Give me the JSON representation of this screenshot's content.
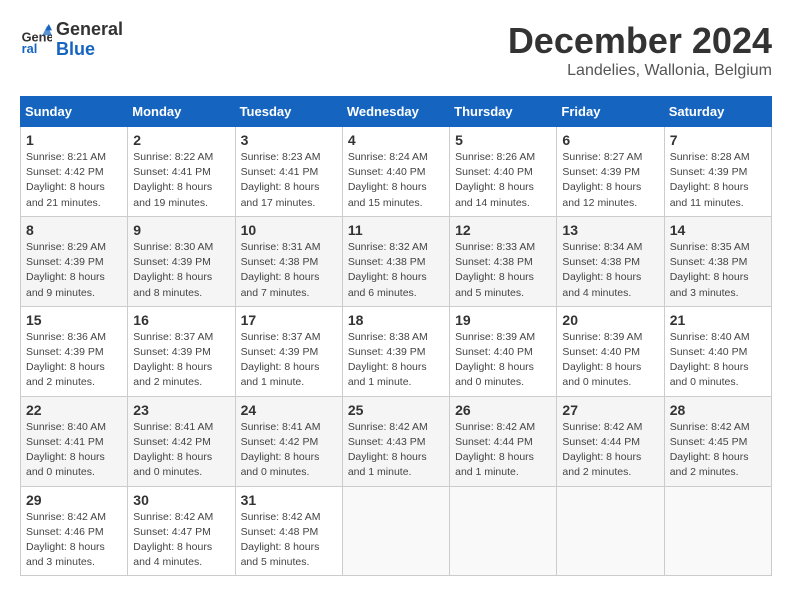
{
  "logo": {
    "line1": "General",
    "line2": "Blue"
  },
  "title": "December 2024",
  "subtitle": "Landelies, Wallonia, Belgium",
  "days_of_week": [
    "Sunday",
    "Monday",
    "Tuesday",
    "Wednesday",
    "Thursday",
    "Friday",
    "Saturday"
  ],
  "weeks": [
    [
      {
        "day": 1,
        "sunrise": "8:21 AM",
        "sunset": "4:42 PM",
        "daylight": "8 hours and 21 minutes."
      },
      {
        "day": 2,
        "sunrise": "8:22 AM",
        "sunset": "4:41 PM",
        "daylight": "8 hours and 19 minutes."
      },
      {
        "day": 3,
        "sunrise": "8:23 AM",
        "sunset": "4:41 PM",
        "daylight": "8 hours and 17 minutes."
      },
      {
        "day": 4,
        "sunrise": "8:24 AM",
        "sunset": "4:40 PM",
        "daylight": "8 hours and 15 minutes."
      },
      {
        "day": 5,
        "sunrise": "8:26 AM",
        "sunset": "4:40 PM",
        "daylight": "8 hours and 14 minutes."
      },
      {
        "day": 6,
        "sunrise": "8:27 AM",
        "sunset": "4:39 PM",
        "daylight": "8 hours and 12 minutes."
      },
      {
        "day": 7,
        "sunrise": "8:28 AM",
        "sunset": "4:39 PM",
        "daylight": "8 hours and 11 minutes."
      }
    ],
    [
      {
        "day": 8,
        "sunrise": "8:29 AM",
        "sunset": "4:39 PM",
        "daylight": "8 hours and 9 minutes."
      },
      {
        "day": 9,
        "sunrise": "8:30 AM",
        "sunset": "4:39 PM",
        "daylight": "8 hours and 8 minutes."
      },
      {
        "day": 10,
        "sunrise": "8:31 AM",
        "sunset": "4:38 PM",
        "daylight": "8 hours and 7 minutes."
      },
      {
        "day": 11,
        "sunrise": "8:32 AM",
        "sunset": "4:38 PM",
        "daylight": "8 hours and 6 minutes."
      },
      {
        "day": 12,
        "sunrise": "8:33 AM",
        "sunset": "4:38 PM",
        "daylight": "8 hours and 5 minutes."
      },
      {
        "day": 13,
        "sunrise": "8:34 AM",
        "sunset": "4:38 PM",
        "daylight": "8 hours and 4 minutes."
      },
      {
        "day": 14,
        "sunrise": "8:35 AM",
        "sunset": "4:38 PM",
        "daylight": "8 hours and 3 minutes."
      }
    ],
    [
      {
        "day": 15,
        "sunrise": "8:36 AM",
        "sunset": "4:39 PM",
        "daylight": "8 hours and 2 minutes."
      },
      {
        "day": 16,
        "sunrise": "8:37 AM",
        "sunset": "4:39 PM",
        "daylight": "8 hours and 2 minutes."
      },
      {
        "day": 17,
        "sunrise": "8:37 AM",
        "sunset": "4:39 PM",
        "daylight": "8 hours and 1 minute."
      },
      {
        "day": 18,
        "sunrise": "8:38 AM",
        "sunset": "4:39 PM",
        "daylight": "8 hours and 1 minute."
      },
      {
        "day": 19,
        "sunrise": "8:39 AM",
        "sunset": "4:40 PM",
        "daylight": "8 hours and 0 minutes."
      },
      {
        "day": 20,
        "sunrise": "8:39 AM",
        "sunset": "4:40 PM",
        "daylight": "8 hours and 0 minutes."
      },
      {
        "day": 21,
        "sunrise": "8:40 AM",
        "sunset": "4:40 PM",
        "daylight": "8 hours and 0 minutes."
      }
    ],
    [
      {
        "day": 22,
        "sunrise": "8:40 AM",
        "sunset": "4:41 PM",
        "daylight": "8 hours and 0 minutes."
      },
      {
        "day": 23,
        "sunrise": "8:41 AM",
        "sunset": "4:42 PM",
        "daylight": "8 hours and 0 minutes."
      },
      {
        "day": 24,
        "sunrise": "8:41 AM",
        "sunset": "4:42 PM",
        "daylight": "8 hours and 0 minutes."
      },
      {
        "day": 25,
        "sunrise": "8:42 AM",
        "sunset": "4:43 PM",
        "daylight": "8 hours and 1 minute."
      },
      {
        "day": 26,
        "sunrise": "8:42 AM",
        "sunset": "4:44 PM",
        "daylight": "8 hours and 1 minute."
      },
      {
        "day": 27,
        "sunrise": "8:42 AM",
        "sunset": "4:44 PM",
        "daylight": "8 hours and 2 minutes."
      },
      {
        "day": 28,
        "sunrise": "8:42 AM",
        "sunset": "4:45 PM",
        "daylight": "8 hours and 2 minutes."
      }
    ],
    [
      {
        "day": 29,
        "sunrise": "8:42 AM",
        "sunset": "4:46 PM",
        "daylight": "8 hours and 3 minutes."
      },
      {
        "day": 30,
        "sunrise": "8:42 AM",
        "sunset": "4:47 PM",
        "daylight": "8 hours and 4 minutes."
      },
      {
        "day": 31,
        "sunrise": "8:42 AM",
        "sunset": "4:48 PM",
        "daylight": "8 hours and 5 minutes."
      },
      null,
      null,
      null,
      null
    ]
  ]
}
